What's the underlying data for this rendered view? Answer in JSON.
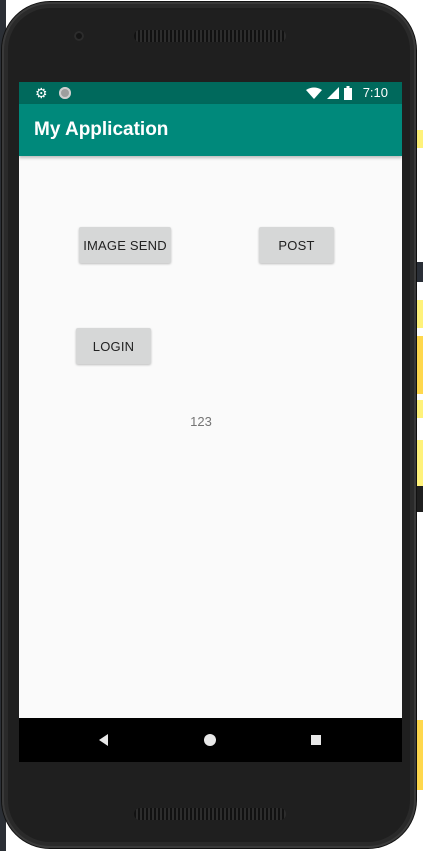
{
  "status_bar": {
    "time": "7:10",
    "left_icons": [
      "gear-icon",
      "circle-icon"
    ],
    "right_icons": [
      "wifi-icon",
      "signal-icon",
      "battery-icon"
    ]
  },
  "app_bar": {
    "title": "My Application",
    "color": "#00897b",
    "status_color": "#00695c"
  },
  "content": {
    "buttons": {
      "image_send": "IMAGE SEND",
      "post": "POST",
      "login": "LOGIN"
    },
    "text_value": "123"
  },
  "nav_bar": {
    "buttons": [
      "back-icon",
      "home-icon",
      "recents-icon"
    ]
  }
}
